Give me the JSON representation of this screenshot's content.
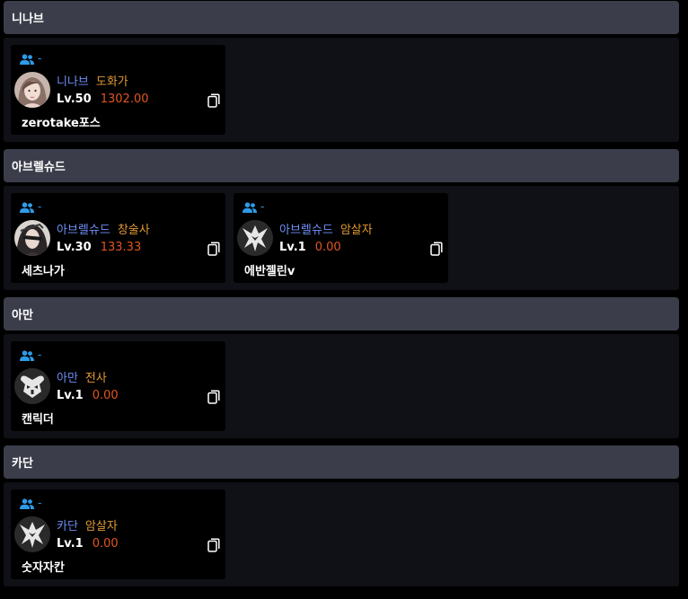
{
  "sections": [
    {
      "title": "니나브",
      "cards": [
        {
          "party": "-",
          "server": "니나브",
          "job": "도화가",
          "level": "Lv.50",
          "power": "1302.00",
          "name": "zerotake포스",
          "avatar_icon": "portrait-avatar-icon"
        }
      ]
    },
    {
      "title": "아브렐슈드",
      "cards": [
        {
          "party": "-",
          "server": "아브렐슈드",
          "job": "창술사",
          "level": "Lv.30",
          "power": "133.33",
          "name": "세츠나가",
          "avatar_icon": "portrait-avatar-icon"
        },
        {
          "party": "-",
          "server": "아브렐슈드",
          "job": "암살자",
          "level": "Lv.1",
          "power": "0.00",
          "name": "에반젤린v",
          "avatar_icon": "assassin-class-icon"
        }
      ]
    },
    {
      "title": "아만",
      "cards": [
        {
          "party": "-",
          "server": "아만",
          "job": "전사",
          "level": "Lv.1",
          "power": "0.00",
          "name": "캔릭더",
          "avatar_icon": "warrior-class-icon"
        }
      ]
    },
    {
      "title": "카단",
      "cards": [
        {
          "party": "-",
          "server": "카단",
          "job": "암살자",
          "level": "Lv.1",
          "power": "0.00",
          "name": "숫자자칸",
          "avatar_icon": "assassin-class-icon"
        }
      ]
    }
  ],
  "colors": {
    "page_background": "#000000",
    "section_header": "#3b3e4a",
    "section_body": "#101117",
    "card": "#000000",
    "party_icon": "#2e9be8",
    "server_text": "#6f8ff7",
    "job_text": "#e29a33",
    "power_text": "#e1561e"
  }
}
